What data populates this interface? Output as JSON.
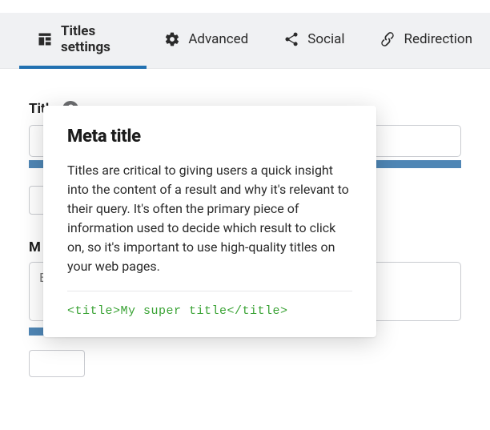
{
  "tabs": [
    {
      "label": "Titles settings",
      "icon": "grid-icon",
      "active": true
    },
    {
      "label": "Advanced",
      "icon": "gear-icon",
      "active": false
    },
    {
      "label": "Social",
      "icon": "share-icon",
      "active": false
    },
    {
      "label": "Redirection",
      "icon": "link-icon",
      "active": false
    }
  ],
  "title_field": {
    "label": "Title",
    "value": ""
  },
  "meta_field": {
    "label_prefix": "M",
    "placeholder": "E"
  },
  "tooltip": {
    "heading": "Meta title",
    "body": "Titles are critical to giving users a quick insight into the content of a result and why it's relevant to their query. It's often the primary piece of information used to decide which result to click on, so it's important to use high-quality titles on your web pages.",
    "code": "<title>My super title</title>"
  },
  "help_glyph": "?"
}
